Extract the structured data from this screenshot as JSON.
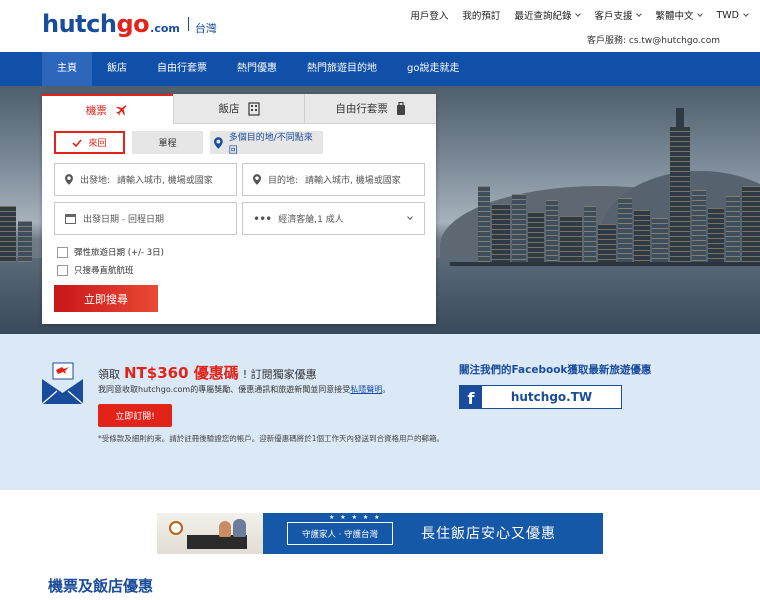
{
  "brand": {
    "logo_hutch": "hutch",
    "logo_go": "go",
    "logo_com": ".com",
    "region": "台灣"
  },
  "topnav": {
    "login": "用戶登入",
    "bookings": "我的預訂",
    "history": "最近查詢紀錄",
    "support": "客戶支援",
    "language": "繁體中文",
    "currency": "TWD"
  },
  "service": "客戶服務: cs.tw@hutchgo.com",
  "mainnav": [
    "主頁",
    "飯店",
    "自由行套票",
    "熱門優惠",
    "熱門旅遊目的地",
    "go說走就走"
  ],
  "search": {
    "tabs": [
      "機票",
      "飯店",
      "自由行套票"
    ],
    "trip_round": "來回",
    "trip_oneway": "單程",
    "trip_multi": "多個目的地/不同點來回",
    "from_label": "出發地:",
    "from_placeholder": "請輸入城市, 機場或國家",
    "to_label": "目的地:",
    "to_placeholder": "請輸入城市, 機場或國家",
    "dates_placeholder": "出發日期 - 回程日期",
    "pax": "經濟客艙,1 成人",
    "flexible": "彈性旅遊日期 (+/- 3日)",
    "direct": "只搜尋直航航班",
    "submit": "立即搜尋"
  },
  "promo": {
    "prefix": "領取",
    "amount": "NT$360 優惠碼",
    "suffix": "! 訂閱獨家優惠",
    "desc": "我同意收取hutchgo.com的專屬獎勵、優惠通訊和旅遊新聞並同意接受",
    "privacy_link": "私隱聲明",
    "desc_end": "。",
    "subscribe": "立即訂閱!",
    "note": "*受條款及細則約束。請於註冊後驗證您的帳戶。迎新優惠碼將於1個工作天內發送到合資格用戶的郵箱。"
  },
  "facebook": {
    "title": "關注我們的Facebook獲取最新旅遊優惠",
    "handle": "hutchgo.TW",
    "f": "f"
  },
  "banner": {
    "stars": "★ ★ ★ ★ ★",
    "badge": "守護家人 · 守護台灣",
    "message": "長住飯店安心又優惠"
  },
  "section_title": "機票及飯店優惠",
  "colors": {
    "brand_blue": "#1a4c9c",
    "nav_blue": "#1150a8",
    "accent_red": "#e2231a",
    "promo_bg": "#dbe9f7"
  },
  "icons": [
    "plane-icon",
    "hotel-icon",
    "luggage-icon",
    "check-icon",
    "pin-icon",
    "location-icon",
    "calendar-icon",
    "dots-icon",
    "chevron-down-icon",
    "envelope-icon",
    "facebook-icon"
  ]
}
